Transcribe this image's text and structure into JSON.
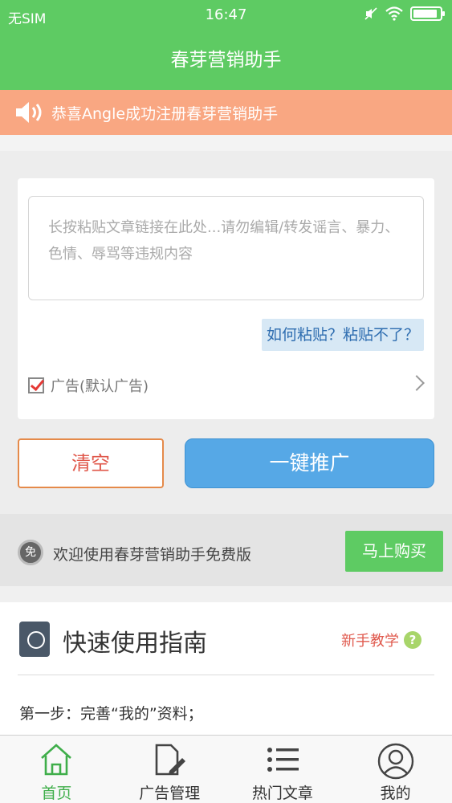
{
  "status_bar": {
    "carrier": "无SIM",
    "time": "16:47",
    "battery_level": 0.9
  },
  "header": {
    "title": "春芽营销助手"
  },
  "notice": {
    "text": "恭喜Angle成功注册春芽营销助手"
  },
  "paste": {
    "placeholder": "长按粘贴文章链接在此处...请勿编辑/转发谣言、暴力、色情、辱骂等违规内容",
    "how_to_paste": "如何粘贴？粘贴不了？",
    "ad_label": "广告(默认广告)",
    "ad_checked": true
  },
  "actions": {
    "clear_label": "清空",
    "promote_label": "一键推广"
  },
  "promo": {
    "badge": "免",
    "text": "欢迎使用春芽营销助手免费版",
    "buy_label": "马上购买"
  },
  "guide": {
    "title": "快速使用指南",
    "newbie_label": "新手教学",
    "help_glyph": "?",
    "step1": "第一步：完善“我的”资料；"
  },
  "tabs": [
    {
      "label": "首页",
      "icon": "home-icon",
      "active": true
    },
    {
      "label": "广告管理",
      "icon": "ad-edit-icon",
      "active": false
    },
    {
      "label": "热门文章",
      "icon": "list-icon",
      "active": false
    },
    {
      "label": "我的",
      "icon": "user-icon",
      "active": false
    }
  ],
  "colors": {
    "primary_green": "#5ecb63",
    "notice_orange": "#f9a782",
    "promote_blue": "#56a8e6",
    "clear_red": "#e0574a"
  }
}
